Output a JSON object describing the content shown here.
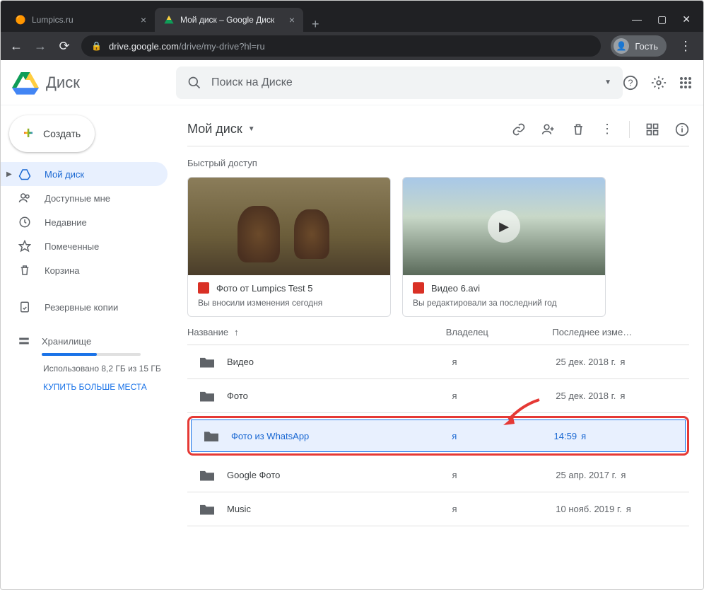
{
  "browser": {
    "tabs": [
      {
        "title": "Lumpics.ru",
        "active": false
      },
      {
        "title": "Мой диск – Google Диск",
        "active": true
      }
    ],
    "url_domain": "drive.google.com",
    "url_path": "/drive/my-drive?hl=ru",
    "guest_label": "Гость"
  },
  "header": {
    "app_name": "Диск",
    "search_placeholder": "Поиск на Диске"
  },
  "sidebar": {
    "create_label": "Создать",
    "items": [
      {
        "label": "Мой диск",
        "active": true
      },
      {
        "label": "Доступные мне"
      },
      {
        "label": "Недавние"
      },
      {
        "label": "Помеченные"
      },
      {
        "label": "Корзина"
      },
      {
        "label": "Резервные копии"
      }
    ],
    "storage": {
      "label": "Хранилище",
      "used_text": "Использовано 8,2 ГБ из 15 ГБ",
      "buy_label": "КУПИТЬ БОЛЬШЕ МЕСТА"
    }
  },
  "main": {
    "breadcrumb": "Мой диск",
    "quick_title": "Быстрый доступ",
    "quick": [
      {
        "name": "Фото от Lumpics Test 5",
        "sub": "Вы вносили изменения сегодня",
        "kind": "image"
      },
      {
        "name": "Видео 6.avi",
        "sub": "Вы редактировали за последний год",
        "kind": "video"
      }
    ],
    "columns": {
      "name": "Название",
      "owner": "Владелец",
      "modified": "Последнее изме…"
    },
    "rows": [
      {
        "name": "Видео",
        "owner": "я",
        "mod": "25 дек. 2018 г.",
        "mod_who": "я"
      },
      {
        "name": "Фото",
        "owner": "я",
        "mod": "25 дек. 2018 г.",
        "mod_who": "я"
      },
      {
        "name": "Фото из WhatsApp",
        "owner": "я",
        "mod": "14:59",
        "mod_who": "я",
        "selected": true
      },
      {
        "name": "Google Фото",
        "owner": "я",
        "mod": "25 апр. 2017 г.",
        "mod_who": "я"
      },
      {
        "name": "Music",
        "owner": "я",
        "mod": "10 нояб. 2019 г.",
        "mod_who": "я"
      }
    ]
  }
}
